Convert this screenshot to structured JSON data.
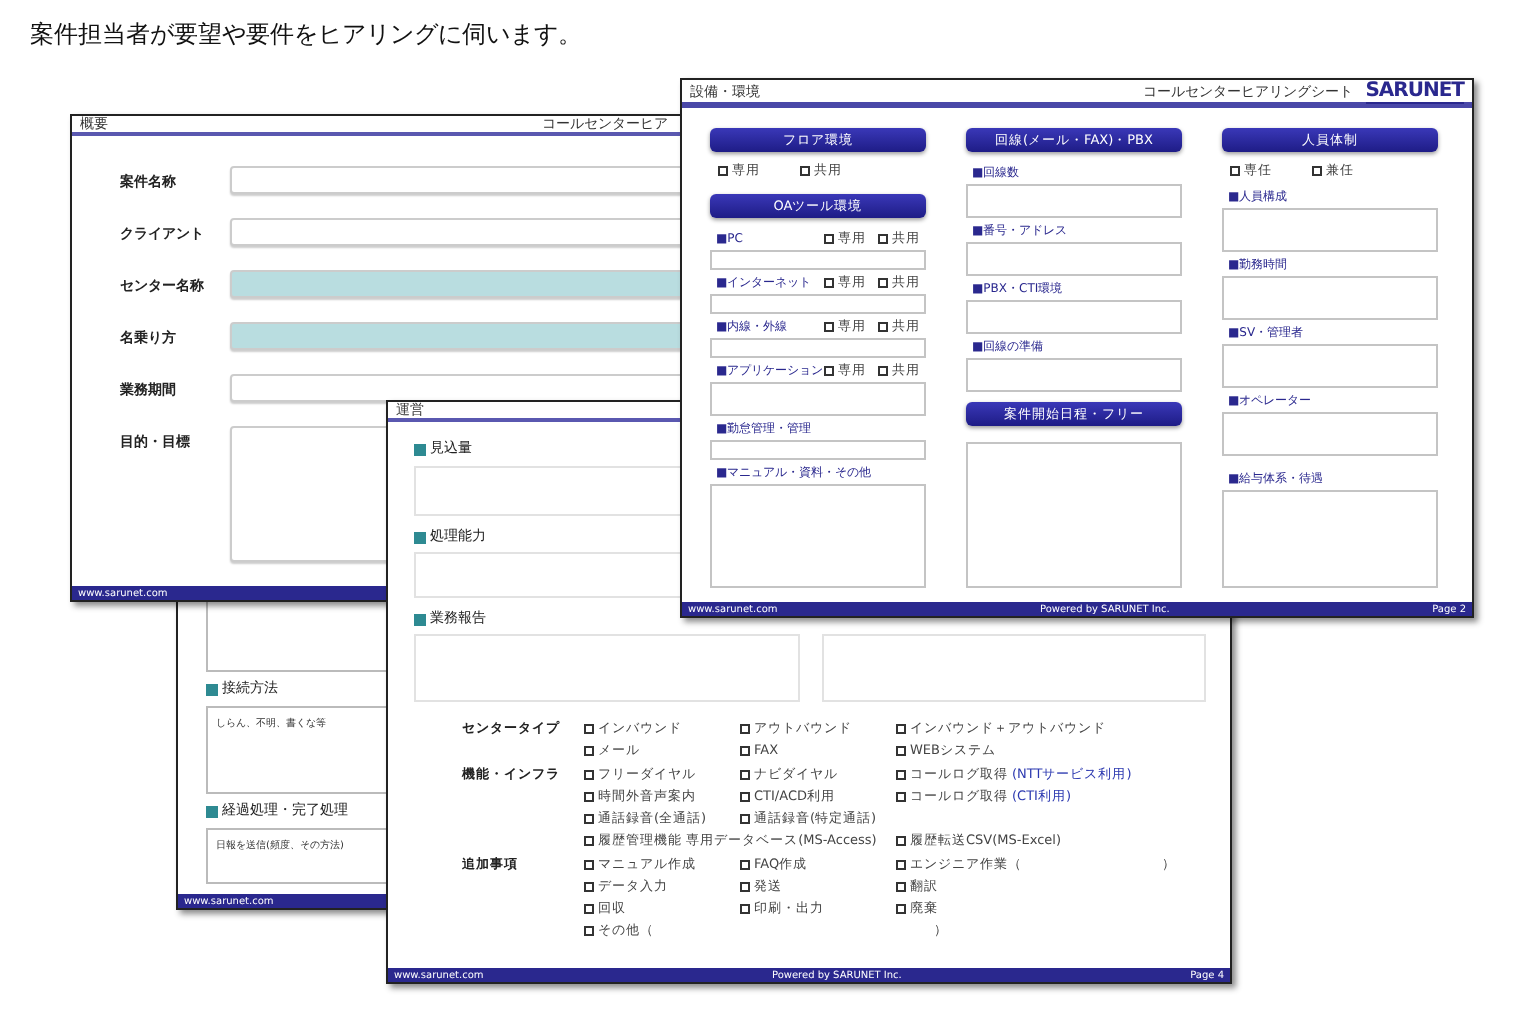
{
  "heading": "案件担当者が要望や要件をヒアリングに伺います。",
  "overview_sheet": {
    "title": "概要",
    "subtitle": "コールセンターヒア",
    "footer": "www.sarunet.com",
    "rows": [
      {
        "label": "案件名称",
        "highlighted": false
      },
      {
        "label": "クライアント",
        "highlighted": false
      },
      {
        "label": "センター名称",
        "highlighted": true
      },
      {
        "label": "名乗り方",
        "highlighted": true
      },
      {
        "label": "業務期間",
        "highlighted": false
      },
      {
        "label": "目的・目標",
        "highlighted": false,
        "kind": "area"
      }
    ]
  },
  "connection_sheet": {
    "footer": "www.sarunet.com",
    "sections": [
      {
        "label": "接続方法",
        "value": "しらん、不明、書くな等"
      },
      {
        "label": "経過処理・完了処理",
        "value": "日報を送信(頻度、その方法)"
      }
    ]
  },
  "operation_sheet": {
    "title": "運営",
    "footer_left": "www.sarunet.com",
    "footer_center": "Powered by SARUNET Inc.",
    "footer_right": "Page 4",
    "sections": [
      {
        "label": "見込量"
      },
      {
        "label": "処理能力"
      },
      {
        "label": "業務報告"
      }
    ],
    "groups": [
      {
        "label": "センタータイプ",
        "rows": [
          [
            {
              "text": "インバウンド",
              "checked": false
            },
            {
              "text": "アウトバウンド",
              "checked": false
            },
            {
              "text": "インバウンド＋アウトバウンド",
              "checked": false
            }
          ],
          [
            {
              "text": "メール",
              "checked": false
            },
            {
              "text": "FAX",
              "checked": false
            },
            {
              "text": "WEBシステム",
              "checked": false
            }
          ]
        ]
      },
      {
        "label": "機能・インフラ",
        "rows": [
          [
            {
              "text": "フリーダイヤル",
              "checked": false
            },
            {
              "text": "ナビダイヤル",
              "checked": false
            },
            {
              "text": "コールログ取得",
              "checked": false,
              "note": "(NTTサービス利用)"
            }
          ],
          [
            {
              "text": "時間外音声案内",
              "checked": false
            },
            {
              "text": "CTI/ACD利用",
              "checked": false
            },
            {
              "text": "コールログ取得",
              "checked": false,
              "note": "(CTI利用)"
            }
          ],
          [
            {
              "text": "通話録音(全通話)",
              "checked": false
            },
            {
              "text": "通話録音(特定通話)",
              "checked": false
            }
          ],
          [
            {
              "text": "履歴管理機能 専用データベース(MS-Access)",
              "checked": false
            },
            "",
            {
              "text": "履歴転送CSV(MS-Excel)",
              "checked": false
            }
          ]
        ]
      },
      {
        "label": "追加事項",
        "rows": [
          [
            {
              "text": "マニュアル作成",
              "checked": false
            },
            {
              "text": "FAQ作成",
              "checked": false
            },
            {
              "text": "エンジニア作業（　　　　　　　　　　）",
              "checked": false
            }
          ],
          [
            {
              "text": "データ入力",
              "checked": false
            },
            {
              "text": "発送",
              "checked": false
            },
            {
              "text": "翻訳",
              "checked": false
            }
          ],
          [
            {
              "text": "回収",
              "checked": false
            },
            {
              "text": "印刷・出力",
              "checked": false
            },
            {
              "text": "廃棄",
              "checked": false
            }
          ],
          [
            {
              "text": "その他（　　　　　　　　　　　　　　　　　　　　）",
              "checked": false
            }
          ]
        ]
      }
    ]
  },
  "environment_sheet": {
    "title": "設備・環境",
    "subtitle": "コールセンターヒアリングシート",
    "logo": "SARUNET",
    "footer_left": "www.sarunet.com",
    "footer_center": "Powered by SARUNET Inc.",
    "footer_right": "Page 2",
    "columns": [
      [
        {
          "kind": "heading",
          "text": "フロア環境"
        },
        {
          "kind": "checks",
          "options": [
            {
              "text": "専用",
              "checked": false
            },
            {
              "text": "共用",
              "checked": false
            }
          ]
        },
        {
          "kind": "heading",
          "text": "OAツール環境"
        },
        {
          "kind": "line",
          "label": "■PC",
          "options": [
            {
              "text": "専用",
              "checked": false
            },
            {
              "text": "共用",
              "checked": false
            }
          ]
        },
        {
          "kind": "line",
          "label": "■インターネット",
          "options": [
            {
              "text": "専用",
              "checked": false
            },
            {
              "text": "共用",
              "checked": false
            }
          ]
        },
        {
          "kind": "line",
          "label": "■内線・外線",
          "options": [
            {
              "text": "専用",
              "checked": false
            },
            {
              "text": "共用",
              "checked": false
            }
          ]
        },
        {
          "kind": "box",
          "label": "■アプリケーション",
          "options": [
            {
              "text": "専用",
              "checked": false
            },
            {
              "text": "共用",
              "checked": false
            }
          ]
        },
        {
          "kind": "line",
          "label": "■勤怠管理・管理"
        },
        {
          "kind": "grow",
          "label": "■マニュアル・資料・その他"
        }
      ],
      [
        {
          "kind": "heading",
          "text": "回線(メール・FAX)・PBX"
        },
        {
          "kind": "box",
          "label": "■回線数"
        },
        {
          "kind": "box",
          "label": "■番号・アドレス"
        },
        {
          "kind": "box",
          "label": "■PBX・CTI環境"
        },
        {
          "kind": "box",
          "label": "■回線の準備"
        },
        {
          "kind": "heading",
          "text": "案件開始日程・フリー"
        },
        {
          "kind": "grow"
        }
      ],
      [
        {
          "kind": "heading",
          "text": "人員体制"
        },
        {
          "kind": "checks",
          "options": [
            {
              "text": "専任",
              "checked": false
            },
            {
              "text": "兼任",
              "checked": false
            }
          ]
        },
        {
          "kind": "area",
          "label": "■人員構成"
        },
        {
          "kind": "area",
          "label": "■勤務時間"
        },
        {
          "kind": "area",
          "label": "■SV・管理者"
        },
        {
          "kind": "area",
          "label": "■オペレーター"
        },
        {
          "kind": "area",
          "label": "■給与体系・待遇"
        }
      ]
    ]
  }
}
